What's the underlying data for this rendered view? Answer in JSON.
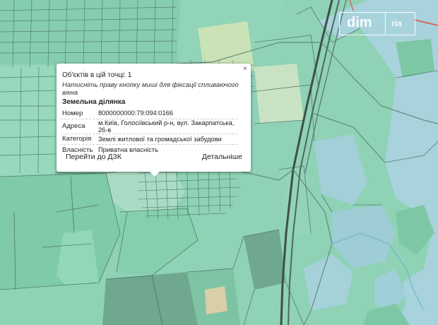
{
  "popup": {
    "count_text": "Об'єктів в цій точці: 1",
    "hint_text": "Натисніть праву кнопку миші для фіксації спливаючого вікна",
    "close_label": "×",
    "section_title": "Земельна ділянка",
    "rows": [
      {
        "key": "Номер",
        "value": "8000000000:79:094:0166"
      },
      {
        "key": "Адреса",
        "value": "м.Київ, Голосіївський р-н, вул. Закарпатська, 26-в"
      },
      {
        "key": "Категорія",
        "value": "Землі житлової та громадської забудови"
      },
      {
        "key": "Власність",
        "value": "Приватна власність"
      }
    ],
    "link_dzk": "Перейти до ДЗК",
    "link_details": "Детальніше"
  },
  "watermark": {
    "left_text": "dim",
    "right_text": "ria"
  },
  "colors": {
    "parcel_green": "#8fd2b6",
    "dark_parcel": "#6fa88e",
    "water": "#a8d3dc",
    "river": "#7ec7cf",
    "road": "#5b7f74",
    "rail": "#3d4f4b"
  }
}
